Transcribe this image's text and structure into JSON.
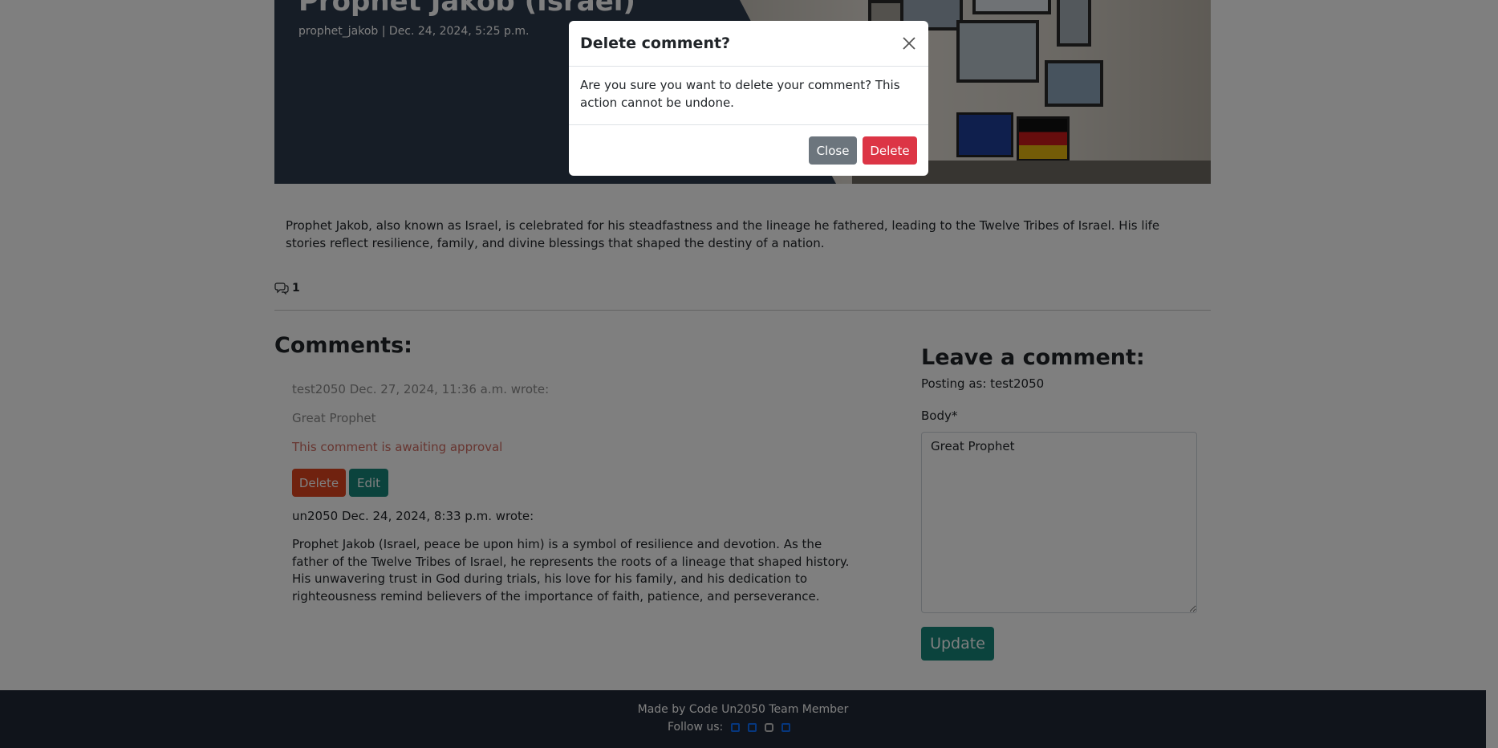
{
  "post": {
    "title": "Prophet Jakob (Israel)",
    "meta": "prophet_jakob | Dec. 24, 2024, 5:25 p.m.",
    "content": "Prophet Jakob, also known as Israel, is celebrated for his steadfastness and the lineage he fathered, leading to the Twelve Tribes of Israel. His life stories reflect resilience, family, and divine blessings that shaped the destiny of a nation.",
    "comment_count": "1"
  },
  "comments": {
    "heading": "Comments:",
    "items": [
      {
        "meta": "test2050 Dec. 27, 2024, 11:36 a.m. wrote:",
        "body": "Great Prophet",
        "status": "This comment is awaiting approval",
        "delete_label": "Delete",
        "edit_label": "Edit"
      },
      {
        "meta": "un2050 Dec. 24, 2024, 8:33 p.m. wrote:",
        "body": "Prophet Jakob (Israel, peace be upon him) is a symbol of resilience and devotion. As the father of the Twelve Tribes of Israel, he represents the roots of a lineage that shaped history. His unwavering trust in God during trials, his love for his family, and his dedication to righteousness remind believers of the importance of faith, patience, and perseverance."
      }
    ]
  },
  "comment_form": {
    "heading": "Leave a comment:",
    "posting_as": "Posting as: test2050",
    "body_label": "Body*",
    "body_value": "Great Prophet",
    "submit_label": "Update"
  },
  "footer": {
    "made_by": "Made by Code Un2050 Team Member",
    "follow_label": "Follow us:",
    "social_icons": [
      "facebook-icon",
      "twitter-icon",
      "instagram-icon",
      "youtube-icon"
    ]
  },
  "modal": {
    "title": "Delete comment?",
    "body": "Are you sure you want to delete your comment? This action cannot be undone.",
    "close_label": "Close",
    "delete_label": "Delete"
  },
  "colors": {
    "hero_bg": "#2d3a4d",
    "teal": "#17867b",
    "danger": "#dc3545",
    "secondary": "#6c757d",
    "footer_bg": "#212936",
    "link_blue": "#0d6efd"
  }
}
